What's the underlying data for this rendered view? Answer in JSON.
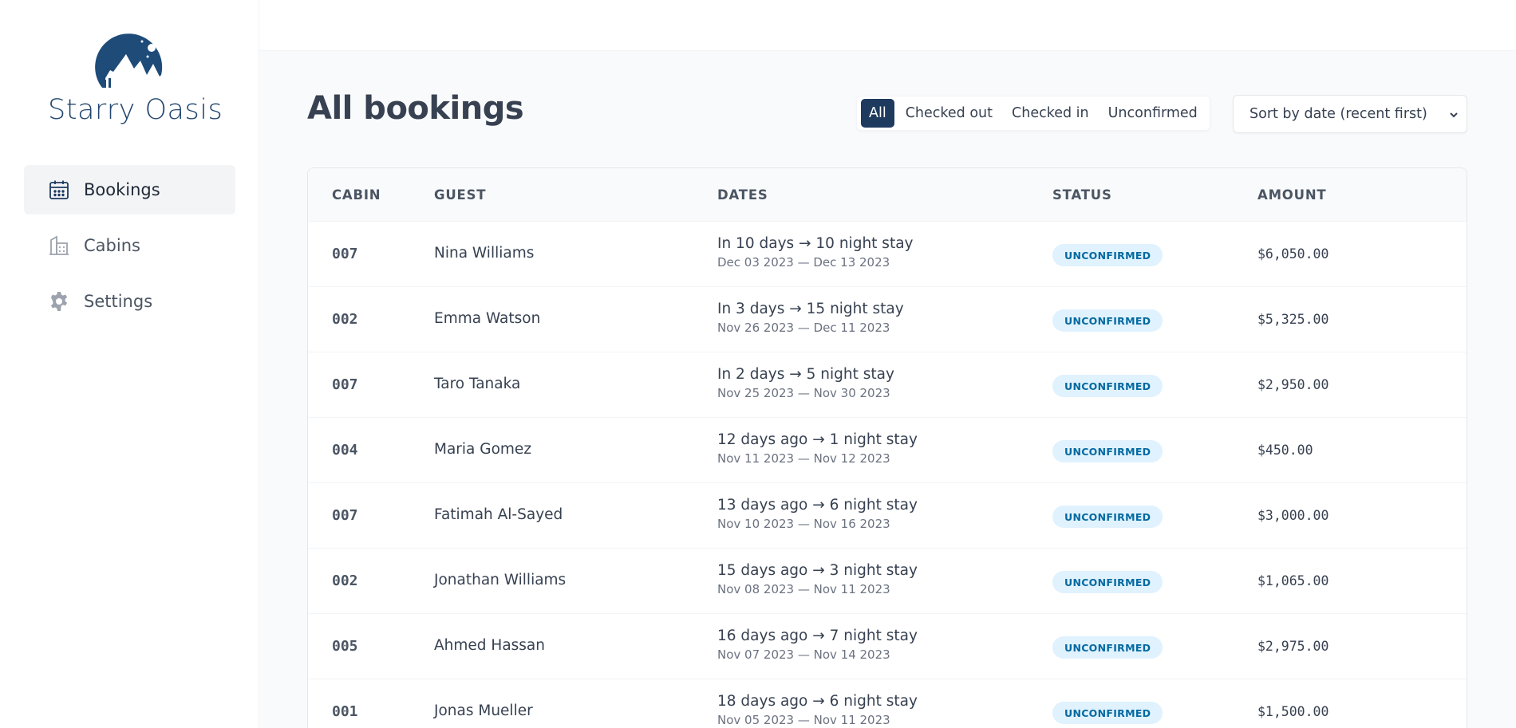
{
  "app": {
    "brand_name": "Starry Oasis",
    "accent_color": "#1e3a5f"
  },
  "sidebar": {
    "items": [
      {
        "label": "Bookings",
        "icon": "calendar-icon",
        "active": true
      },
      {
        "label": "Cabins",
        "icon": "building-icon",
        "active": false
      },
      {
        "label": "Settings",
        "icon": "gear-icon",
        "active": false
      }
    ]
  },
  "header": {
    "title": "All bookings"
  },
  "filter": {
    "options": [
      "All",
      "Checked out",
      "Checked in",
      "Unconfirmed"
    ],
    "selected": "All"
  },
  "sort": {
    "selected": "Sort by date (recent first)"
  },
  "table": {
    "columns": [
      "CABIN",
      "GUEST",
      "DATES",
      "STATUS",
      "AMOUNT"
    ],
    "rows": [
      {
        "cabin": "007",
        "guest": "Nina Williams",
        "dates_main": "In 10 days → 10 night stay",
        "dates_sub": "Dec 03 2023 — Dec 13 2023",
        "status": "UNCONFIRMED",
        "amount": "$6,050.00"
      },
      {
        "cabin": "002",
        "guest": "Emma Watson",
        "dates_main": "In 3 days → 15 night stay",
        "dates_sub": "Nov 26 2023 — Dec 11 2023",
        "status": "UNCONFIRMED",
        "amount": "$5,325.00"
      },
      {
        "cabin": "007",
        "guest": "Taro Tanaka",
        "dates_main": "In 2 days → 5 night stay",
        "dates_sub": "Nov 25 2023 — Nov 30 2023",
        "status": "UNCONFIRMED",
        "amount": "$2,950.00"
      },
      {
        "cabin": "004",
        "guest": "Maria Gomez",
        "dates_main": "12 days ago → 1 night stay",
        "dates_sub": "Nov 11 2023 — Nov 12 2023",
        "status": "UNCONFIRMED",
        "amount": "$450.00"
      },
      {
        "cabin": "007",
        "guest": "Fatimah Al-Sayed",
        "dates_main": "13 days ago → 6 night stay",
        "dates_sub": "Nov 10 2023 — Nov 16 2023",
        "status": "UNCONFIRMED",
        "amount": "$3,000.00"
      },
      {
        "cabin": "002",
        "guest": "Jonathan Williams",
        "dates_main": "15 days ago → 3 night stay",
        "dates_sub": "Nov 08 2023 — Nov 11 2023",
        "status": "UNCONFIRMED",
        "amount": "$1,065.00"
      },
      {
        "cabin": "005",
        "guest": "Ahmed Hassan",
        "dates_main": "16 days ago → 7 night stay",
        "dates_sub": "Nov 07 2023 — Nov 14 2023",
        "status": "UNCONFIRMED",
        "amount": "$2,975.00"
      },
      {
        "cabin": "001",
        "guest": "Jonas Mueller",
        "dates_main": "18 days ago → 6 night stay",
        "dates_sub": "Nov 05 2023 — Nov 11 2023",
        "status": "UNCONFIRMED",
        "amount": "$1,500.00"
      }
    ]
  }
}
